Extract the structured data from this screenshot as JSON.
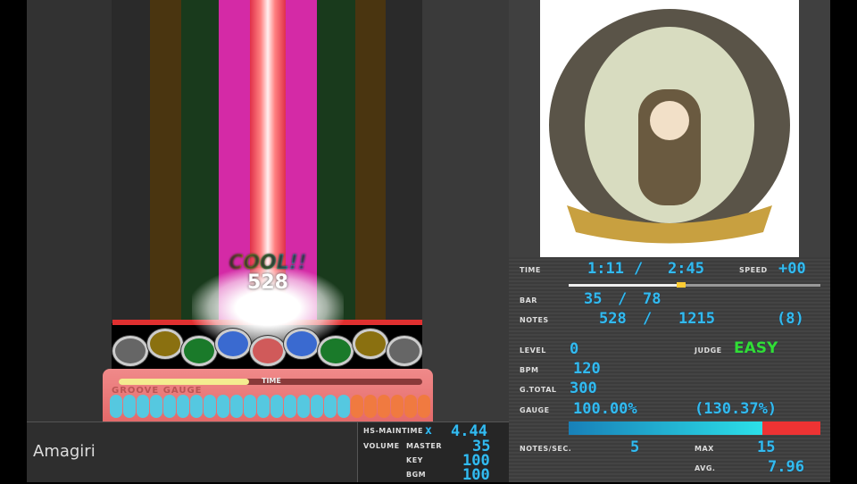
{
  "judgement": {
    "text": "COOL!!",
    "combo": "528"
  },
  "gauge_panel": {
    "groove_label": "GROOVE GAUGE",
    "time_label": "TIME",
    "time_progress": 0.43,
    "segments_filled": 24,
    "segments_total": 24,
    "segment_colors": {
      "normal": "#55c8e0",
      "clear": "#f07a40"
    }
  },
  "song": {
    "title": "Amagiri"
  },
  "settings": {
    "hs_label": "HS-MAINTIME",
    "hs_x": "x",
    "hs_value": "4.44",
    "volume_label": "VOLUME",
    "master_label": "MASTER",
    "master": "35",
    "key_label": "KEY",
    "key": "100",
    "bgm_label": "BGM",
    "bgm": "100"
  },
  "stats": {
    "time_label": "TIME",
    "time_current": "1:11",
    "time_total": "2:45",
    "time_slash": "/",
    "speed_label": "SPEED",
    "speed": "+00",
    "progress": 0.43,
    "bar_label": "BAR",
    "bar_current": "35",
    "bar_total": "78",
    "notes_label": "NOTES",
    "notes_current": "528",
    "notes_total": "1215",
    "notes_extra": "(8)",
    "level_label": "LEVEL",
    "level": "0",
    "judge_label": "JUDGE",
    "judge": "EASY",
    "bpm_label": "BPM",
    "bpm": "120",
    "gtotal_label": "G.TOTAL",
    "gtotal": "300",
    "gauge_label": "GAUGE",
    "gauge": "100.00%",
    "gauge_extra": "(130.37%)",
    "gauge_fraction": 0.77,
    "nps_label": "NOTES/SEC.",
    "nps": "5",
    "max_label": "MAX",
    "max": "15",
    "avg_label": "AVG.",
    "avg": "7.96"
  },
  "colors": {
    "accent": "#33bbee",
    "judge_easy": "#33dd33",
    "gauge_bar": "#2ce0e8",
    "gauge_rest": "#ee3333"
  }
}
